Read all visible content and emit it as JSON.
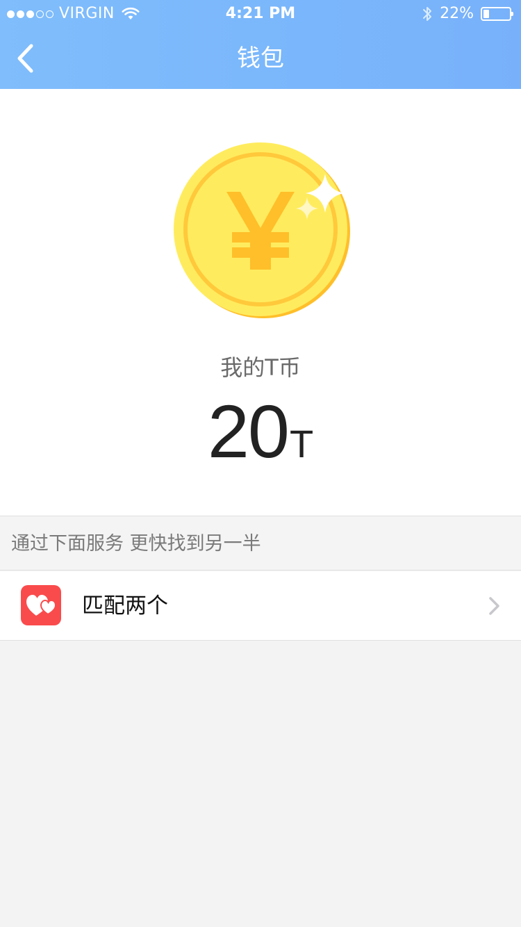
{
  "status_bar": {
    "carrier": "VIRGIN",
    "time": "4:21 PM",
    "battery_text": "22%",
    "battery_level": 0.22,
    "signal_bars_filled": 3,
    "signal_bars_total": 5
  },
  "nav": {
    "title": "钱包",
    "back_icon": "chevron-left-icon"
  },
  "wallet": {
    "coin_icon": "yen-coin-icon",
    "label": "我的T币",
    "amount": "20",
    "unit": "T"
  },
  "services": {
    "caption": "通过下面服务 更快找到另一半",
    "items": [
      {
        "label": "匹配两个",
        "icon": "hearts-icon",
        "icon_color": "#fa4b4c"
      }
    ]
  },
  "colors": {
    "header_blue": "#7ab6fb",
    "coin_yellow": "#ffeb5b",
    "coin_orange": "#ffbf2a",
    "service_red": "#fa4b4c",
    "background_gray": "#f3f3f3"
  }
}
